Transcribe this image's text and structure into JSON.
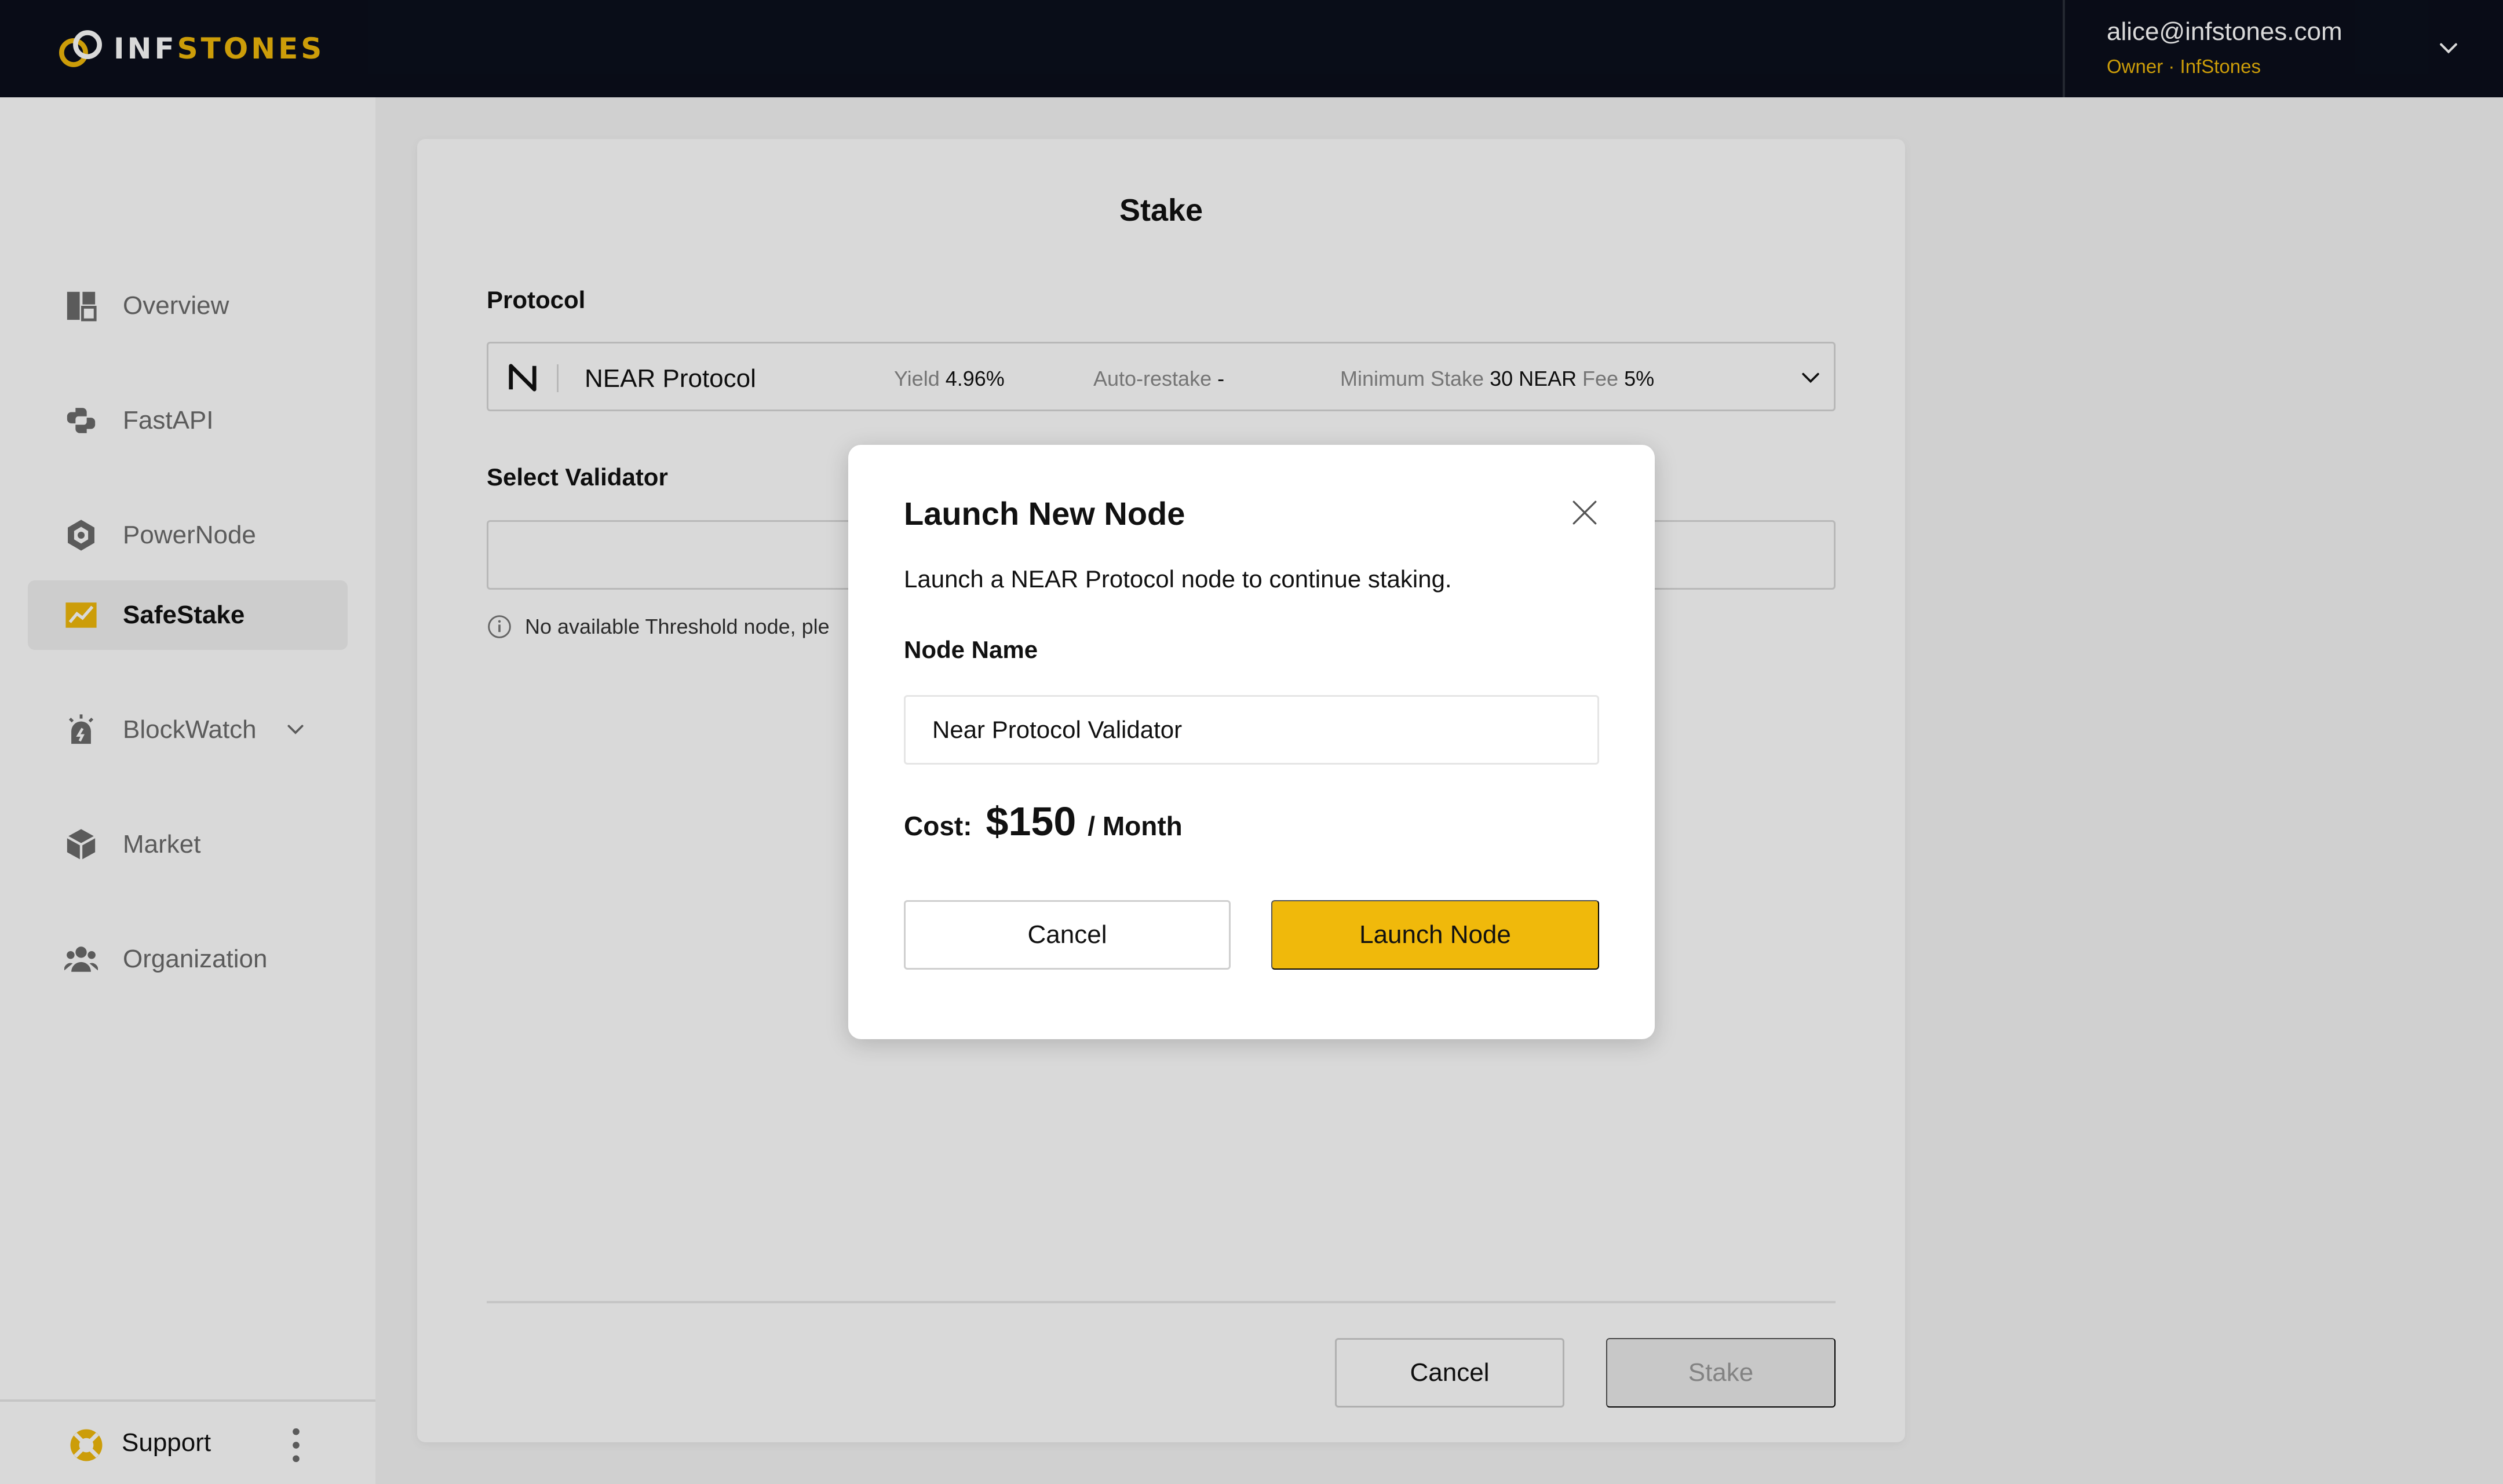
{
  "colors": {
    "accent": "#f0b90b",
    "header_bg": "#0b0f1c"
  },
  "brand": {
    "logo_part1": "INF",
    "logo_part2": "STONES"
  },
  "account": {
    "email": "alice@infstones.com",
    "role": "Owner · InfStones"
  },
  "sidebar": {
    "items": [
      {
        "label": "Overview",
        "icon": "overview-icon"
      },
      {
        "label": "FastAPI",
        "icon": "fastapi-icon"
      },
      {
        "label": "PowerNode",
        "icon": "powernode-icon"
      },
      {
        "label": "SafeStake",
        "icon": "chart-icon",
        "active": true
      },
      {
        "label": "BlockWatch",
        "icon": "alarm-icon",
        "expandable": true
      },
      {
        "label": "Market",
        "icon": "market-icon"
      },
      {
        "label": "Organization",
        "icon": "organization-icon"
      }
    ],
    "footer": {
      "label": "Support",
      "icon": "lifebuoy-icon"
    }
  },
  "stake": {
    "title": "Stake",
    "protocol_label": "Protocol",
    "protocol": {
      "name": "NEAR Protocol",
      "yield_label": "Yield",
      "yield_value": "4.96%",
      "restake_label": "Auto-restake",
      "restake_value": "-",
      "min_label": "Minimum Stake",
      "min_value": "30 NEAR",
      "fee_label": "Fee",
      "fee_value": "5%"
    },
    "validator_label": "Select Validator",
    "info_text": "No available Threshold node, ple",
    "cancel_label": "Cancel",
    "stake_label": "Stake"
  },
  "modal": {
    "title": "Launch New Node",
    "description": "Launch a NEAR Protocol node to continue staking.",
    "node_name_label": "Node Name",
    "node_name_value": "Near Protocol Validator",
    "cost_label": "Cost:",
    "cost_amount": "$150",
    "cost_unit": "/ Month",
    "cancel_label": "Cancel",
    "launch_label": "Launch Node"
  }
}
